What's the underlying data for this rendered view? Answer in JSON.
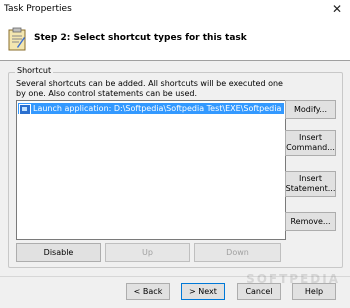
{
  "window": {
    "title": "Task Properties",
    "close_glyph": "✕"
  },
  "header": {
    "heading": "Step 2: Select shortcut types for this task",
    "icon": "clipboard-icon"
  },
  "group": {
    "legend": "Shortcut",
    "description": "Several shortcuts can be added. All shortcuts will be executed one by one. Also control statements can be used."
  },
  "list": {
    "items": [
      {
        "label": "Launch application: D:\\Softpedia\\Softpedia Test\\EXE\\Softpedia New.e...",
        "selected": true,
        "icon": "application-icon"
      }
    ]
  },
  "side_buttons": {
    "modify": "Modify...",
    "insert_command_line1": "Insert",
    "insert_command_line2": "Command...",
    "insert_statement_line1": "Insert",
    "insert_statement_line2": "Statement...",
    "remove": "Remove..."
  },
  "bottom_buttons": {
    "disable": "Disable",
    "up": "Up",
    "down": "Down"
  },
  "footer": {
    "back": "< Back",
    "next": "> Next",
    "cancel": "Cancel",
    "help": "Help"
  },
  "watermark": "SOFTPEDIA"
}
